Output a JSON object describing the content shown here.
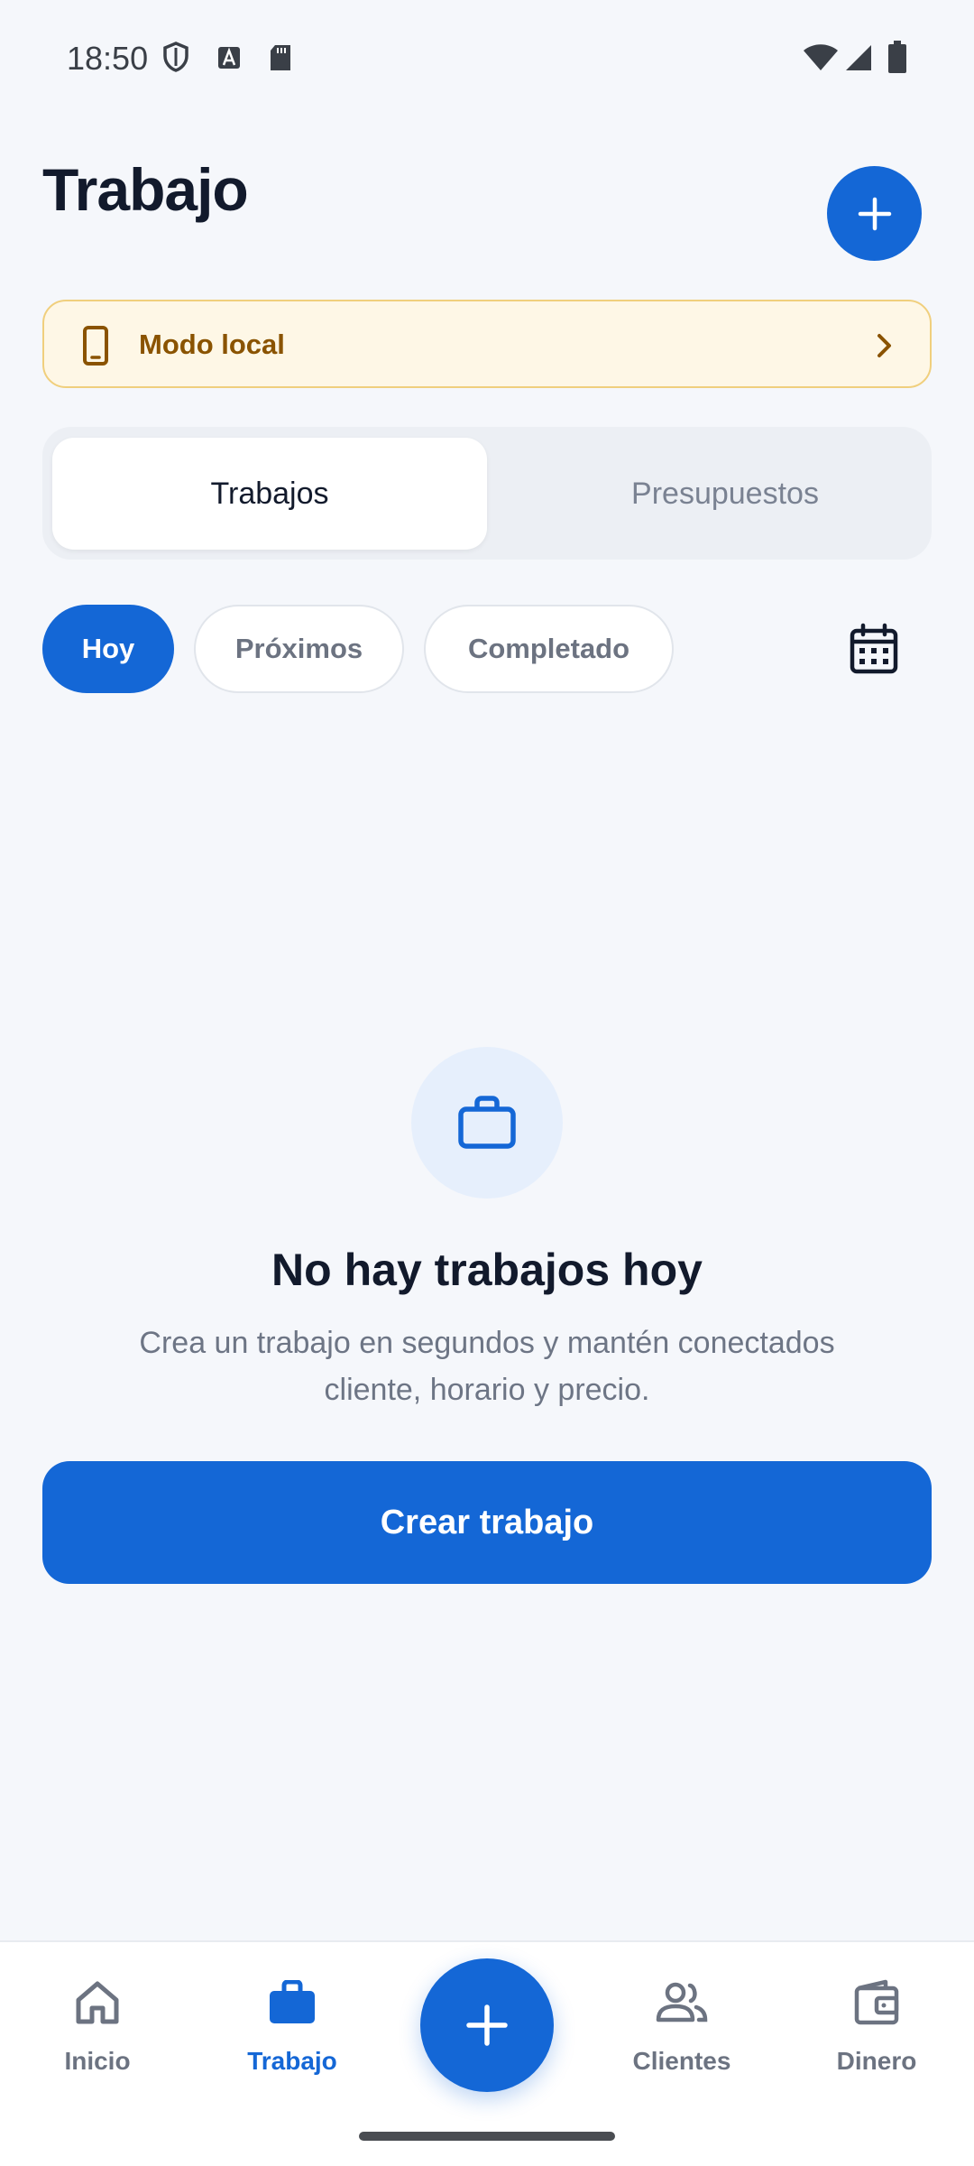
{
  "status_bar": {
    "time": "18:50"
  },
  "header": {
    "title": "Trabajo"
  },
  "banner": {
    "label": "Modo local"
  },
  "segmented": {
    "tabs": [
      {
        "label": "Trabajos"
      },
      {
        "label": "Presupuestos"
      }
    ]
  },
  "filters": {
    "chips": [
      {
        "label": "Hoy"
      },
      {
        "label": "Próximos"
      },
      {
        "label": "Completado"
      }
    ]
  },
  "empty_state": {
    "title": "No hay trabajos hoy",
    "description_line1": "Crea un trabajo en segundos y mantén conectados",
    "description_line2": "cliente, horario y precio.",
    "button_label": "Crear trabajo"
  },
  "bottom_nav": {
    "items": [
      {
        "label": "Inicio",
        "icon": "home-icon"
      },
      {
        "label": "Trabajo",
        "icon": "briefcase-icon"
      },
      {
        "label": "Clientes",
        "icon": "people-icon"
      },
      {
        "label": "Dinero",
        "icon": "wallet-icon"
      }
    ]
  },
  "colors": {
    "accent": "#1467d6",
    "banner_bg": "#fef7e6",
    "banner_text": "#8a5300"
  }
}
